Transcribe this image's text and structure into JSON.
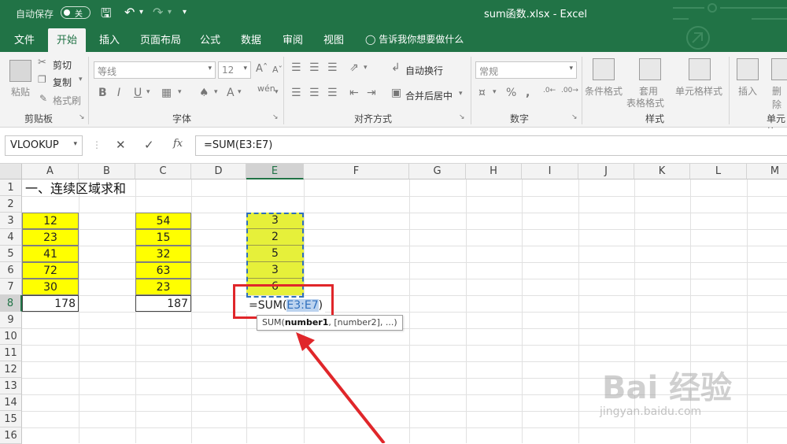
{
  "titlebar": {
    "autosave_label": "自动保存",
    "toggle_text": "关",
    "document_title": "sum函数.xlsx  -  Excel",
    "accent": "#217346"
  },
  "tabs": [
    "文件",
    "开始",
    "插入",
    "页面布局",
    "公式",
    "数据",
    "审阅",
    "视图"
  ],
  "active_tab": "开始",
  "tell_me": "告诉我你想要做什么",
  "ribbon": {
    "clipboard": {
      "paste": "粘贴",
      "cut": "剪切",
      "copy": "复制",
      "format_painter": "格式刷",
      "label": "剪贴板"
    },
    "font": {
      "font_name": "等线",
      "font_size": "12",
      "label": "字体"
    },
    "alignment": {
      "wrap_text": "自动换行",
      "merge_center": "合并后居中",
      "label": "对齐方式"
    },
    "number": {
      "format": "常规",
      "label": "数字"
    },
    "styles": {
      "conditional": "条件格式",
      "table_format_1": "套用",
      "table_format_2": "表格格式",
      "cell_styles": "单元格样式",
      "label": "样式"
    },
    "cells": {
      "insert": "插入",
      "delete": "删除",
      "label": "单元格"
    }
  },
  "formula_bar": {
    "name_box": "VLOOKUP",
    "fx_label": "fx",
    "formula": "=SUM(E3:E7)"
  },
  "columns": [
    "A",
    "B",
    "C",
    "D",
    "E",
    "F",
    "G",
    "H",
    "I",
    "J",
    "K",
    "L",
    "M"
  ],
  "selected_column": "E",
  "rows": [
    "1",
    "2",
    "3",
    "4",
    "5",
    "6",
    "7",
    "8",
    "9",
    "10",
    "11",
    "12",
    "13",
    "14",
    "15",
    "16"
  ],
  "selected_row": "8",
  "sheet": {
    "title": "一、连续区域求和",
    "colA": [
      "12",
      "23",
      "41",
      "72",
      "30"
    ],
    "colA_sum": "178",
    "colC": [
      "54",
      "15",
      "32",
      "63",
      "23"
    ],
    "colC_sum": "187",
    "colE": [
      "3",
      "2",
      "5",
      "3",
      "6"
    ],
    "edit_prefix": "=SUM(",
    "edit_ref": "E3:E7",
    "edit_suffix": ")"
  },
  "tooltip": {
    "fn": "SUM(",
    "arg1": "number1",
    "rest": ", [number2], ...)"
  },
  "watermark": {
    "main": "Bai 经验",
    "sub": "jingyan.baidu.com"
  }
}
